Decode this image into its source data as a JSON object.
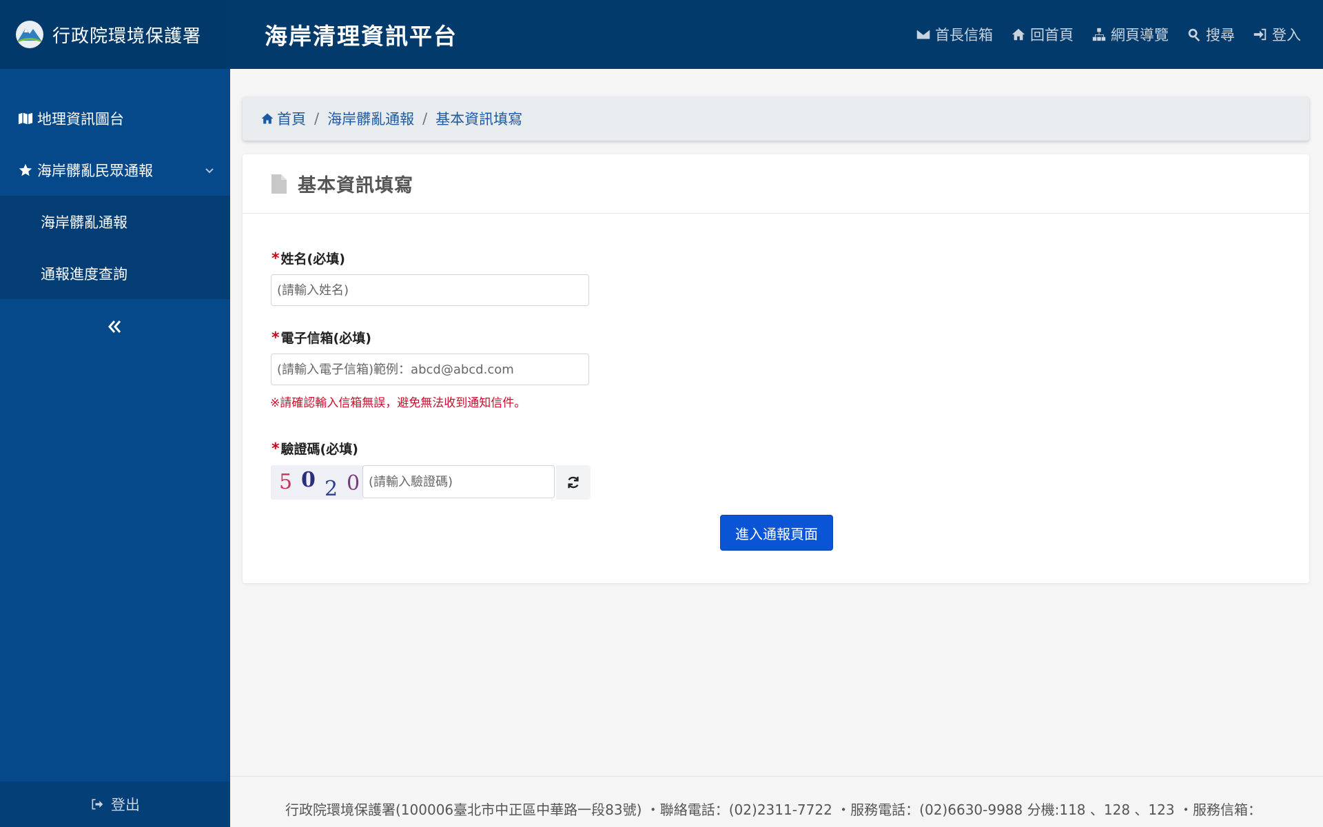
{
  "header": {
    "agency_name": "行政院環境保護署",
    "site_title": "海岸清理資訊平台",
    "nav": [
      {
        "label": "首長信箱",
        "icon": "envelope-icon"
      },
      {
        "label": "回首頁",
        "icon": "home-icon"
      },
      {
        "label": "網頁導覽",
        "icon": "sitemap-icon"
      },
      {
        "label": "搜尋",
        "icon": "search-icon"
      },
      {
        "label": "登入",
        "icon": "sign-in-icon"
      }
    ]
  },
  "sidebar": {
    "items": [
      {
        "label": "地理資訊圖台",
        "icon": "map-icon"
      },
      {
        "label": "海岸髒亂民眾通報",
        "icon": "star-icon"
      }
    ],
    "submenu": [
      {
        "label": "海岸髒亂通報"
      },
      {
        "label": "通報進度查詢"
      }
    ],
    "logout_label": "登出"
  },
  "breadcrumb": {
    "home": "首頁",
    "level1": "海岸髒亂通報",
    "current": "基本資訊填寫"
  },
  "form": {
    "title": "基本資訊填寫",
    "name_label": "姓名(必填)",
    "name_placeholder": "(請輸入姓名)",
    "email_label": "電子信箱(必填)",
    "email_placeholder": "(請輸入電子信箱)範例：abcd@abcd.com",
    "email_warning": "※請確認輸入信箱無誤，避免無法收到通知信件。",
    "captcha_label": "驗證碼(必填)",
    "captcha_code": [
      "5",
      "0",
      "2",
      "0"
    ],
    "captcha_placeholder": "(請輸入驗證碼)",
    "submit_label": "進入通報頁面",
    "required_mark": "*"
  },
  "footer": {
    "text": "行政院環境保護署(100006臺北市中正區中華路一段83號) ・聯絡電話：(02)2311-7722 ・服務電話：(02)6630-9988 分機:118 、128 、123 ・服務信箱："
  },
  "colors": {
    "header_bg": "#023a6c",
    "sidebar_bg": "#05498a",
    "submenu_bg": "#033d73",
    "primary_button": "#0a55d6",
    "required": "#d0021b",
    "link": "#1d5aa6"
  }
}
